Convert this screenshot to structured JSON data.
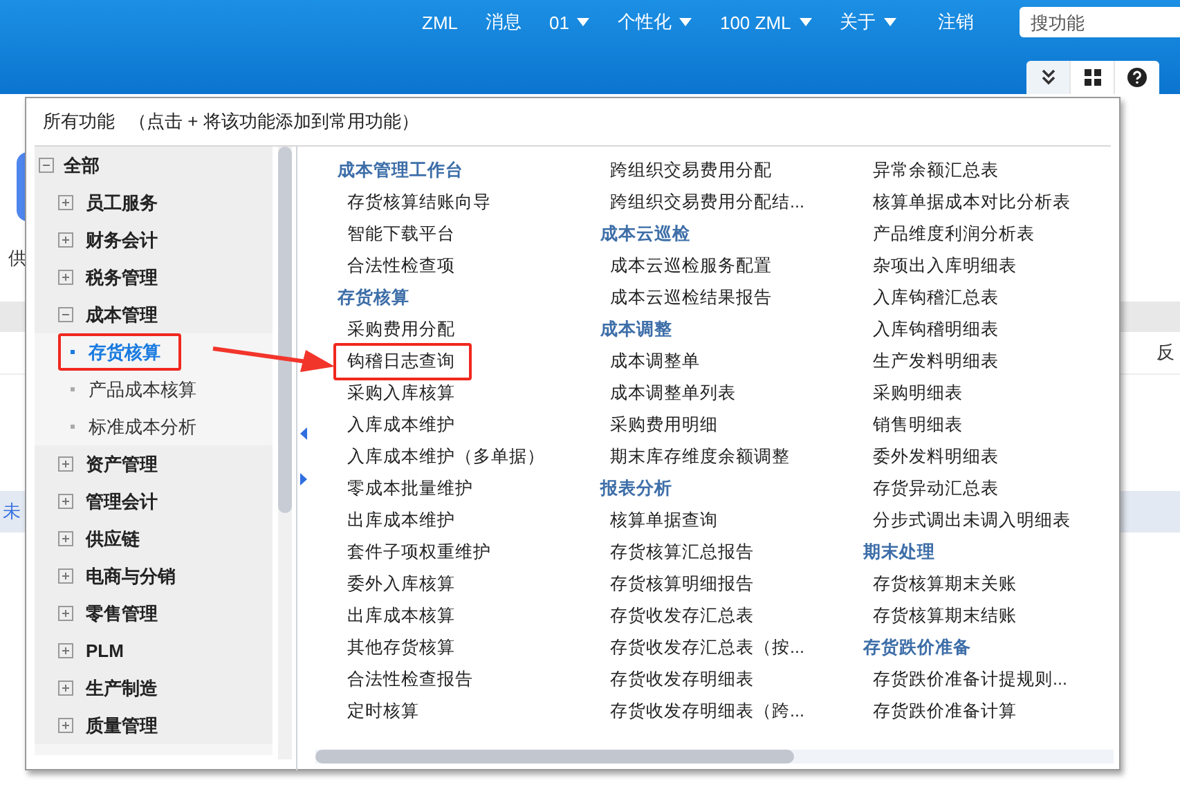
{
  "header": {
    "nav": [
      {
        "label": "ZML",
        "dropdown": false
      },
      {
        "label": "消息",
        "dropdown": false
      },
      {
        "label": "01",
        "dropdown": true
      },
      {
        "label": "个性化",
        "dropdown": true
      },
      {
        "label": "100  ZML",
        "dropdown": true
      },
      {
        "label": "关于",
        "dropdown": true
      },
      {
        "label": "注销",
        "dropdown": false
      }
    ],
    "search": {
      "placeholder": "搜功能"
    }
  },
  "background": {
    "app_label": "供",
    "band_text": "反",
    "notice_text": "未"
  },
  "popup": {
    "title": "所有功能",
    "hint": "（点击 + 将该功能添加到常用功能）",
    "tree": [
      {
        "label": "全部",
        "expanded": true,
        "children": [
          {
            "label": "员工服务",
            "expanded": false
          },
          {
            "label": "财务会计",
            "expanded": false
          },
          {
            "label": "税务管理",
            "expanded": false
          },
          {
            "label": "成本管理",
            "expanded": true,
            "children": [
              {
                "label": "存货核算",
                "selected": true,
                "highlighted": true
              },
              {
                "label": "产品成本核算",
                "selected": false,
                "highlighted": false
              },
              {
                "label": "标准成本分析",
                "selected": false,
                "highlighted": false
              }
            ]
          },
          {
            "label": "资产管理",
            "expanded": false
          },
          {
            "label": "管理会计",
            "expanded": false
          },
          {
            "label": "供应链",
            "expanded": false
          },
          {
            "label": "电商与分销",
            "expanded": false
          },
          {
            "label": "零售管理",
            "expanded": false
          },
          {
            "label": "PLM",
            "expanded": false
          },
          {
            "label": "生产制造",
            "expanded": false
          },
          {
            "label": "质量管理",
            "expanded": false
          }
        ]
      }
    ],
    "columns": [
      [
        {
          "kind": "heading",
          "label": "成本管理工作台"
        },
        {
          "kind": "item",
          "label": "存货核算结账向导",
          "highlighted": false
        },
        {
          "kind": "item",
          "label": "智能下载平台",
          "highlighted": false
        },
        {
          "kind": "item",
          "label": "合法性检查项",
          "highlighted": false
        },
        {
          "kind": "heading",
          "label": "存货核算"
        },
        {
          "kind": "item",
          "label": "采购费用分配",
          "highlighted": false
        },
        {
          "kind": "item",
          "label": "钩稽日志查询",
          "highlighted": true
        },
        {
          "kind": "item",
          "label": "采购入库核算",
          "highlighted": false
        },
        {
          "kind": "item",
          "label": "入库成本维护",
          "highlighted": false
        },
        {
          "kind": "item",
          "label": "入库成本维护（多单据）",
          "highlighted": false
        },
        {
          "kind": "item",
          "label": "零成本批量维护",
          "highlighted": false
        },
        {
          "kind": "item",
          "label": "出库成本维护",
          "highlighted": false
        },
        {
          "kind": "item",
          "label": "套件子项权重维护",
          "highlighted": false
        },
        {
          "kind": "item",
          "label": "委外入库核算",
          "highlighted": false
        },
        {
          "kind": "item",
          "label": "出库成本核算",
          "highlighted": false
        },
        {
          "kind": "item",
          "label": "其他存货核算",
          "highlighted": false
        },
        {
          "kind": "item",
          "label": "合法性检查报告",
          "highlighted": false
        },
        {
          "kind": "item",
          "label": "定时核算",
          "highlighted": false
        }
      ],
      [
        {
          "kind": "item",
          "label": "跨组织交易费用分配",
          "highlighted": false
        },
        {
          "kind": "item",
          "label": "跨组织交易费用分配结...",
          "highlighted": false
        },
        {
          "kind": "heading",
          "label": "成本云巡检"
        },
        {
          "kind": "item",
          "label": "成本云巡检服务配置",
          "highlighted": false
        },
        {
          "kind": "item",
          "label": "成本云巡检结果报告",
          "highlighted": false
        },
        {
          "kind": "heading",
          "label": "成本调整"
        },
        {
          "kind": "item",
          "label": "成本调整单",
          "highlighted": false
        },
        {
          "kind": "item",
          "label": "成本调整单列表",
          "highlighted": false
        },
        {
          "kind": "item",
          "label": "采购费用明细",
          "highlighted": false
        },
        {
          "kind": "item",
          "label": "期末库存维度余额调整",
          "highlighted": false
        },
        {
          "kind": "heading",
          "label": "报表分析"
        },
        {
          "kind": "item",
          "label": "核算单据查询",
          "highlighted": false
        },
        {
          "kind": "item",
          "label": "存货核算汇总报告",
          "highlighted": false
        },
        {
          "kind": "item",
          "label": "存货核算明细报告",
          "highlighted": false
        },
        {
          "kind": "item",
          "label": "存货收发存汇总表",
          "highlighted": false
        },
        {
          "kind": "item",
          "label": "存货收发存汇总表（按...",
          "highlighted": false
        },
        {
          "kind": "item",
          "label": "存货收发存明细表",
          "highlighted": false
        },
        {
          "kind": "item",
          "label": "存货收发存明细表（跨...",
          "highlighted": false
        }
      ],
      [
        {
          "kind": "item",
          "label": "异常余额汇总表",
          "highlighted": false
        },
        {
          "kind": "item",
          "label": "核算单据成本对比分析表",
          "highlighted": false
        },
        {
          "kind": "item",
          "label": "产品维度利润分析表",
          "highlighted": false
        },
        {
          "kind": "item",
          "label": "杂项出入库明细表",
          "highlighted": false
        },
        {
          "kind": "item",
          "label": "入库钩稽汇总表",
          "highlighted": false
        },
        {
          "kind": "item",
          "label": "入库钩稽明细表",
          "highlighted": false
        },
        {
          "kind": "item",
          "label": "生产发料明细表",
          "highlighted": false
        },
        {
          "kind": "item",
          "label": "采购明细表",
          "highlighted": false
        },
        {
          "kind": "item",
          "label": "销售明细表",
          "highlighted": false
        },
        {
          "kind": "item",
          "label": "委外发料明细表",
          "highlighted": false
        },
        {
          "kind": "item",
          "label": "存货异动汇总表",
          "highlighted": false
        },
        {
          "kind": "item",
          "label": "分步式调出未调入明细表",
          "highlighted": false
        },
        {
          "kind": "heading",
          "label": "期末处理"
        },
        {
          "kind": "item",
          "label": "存货核算期末关账",
          "highlighted": false
        },
        {
          "kind": "item",
          "label": "存货核算期末结账",
          "highlighted": false
        },
        {
          "kind": "heading",
          "label": "存货跌价准备"
        },
        {
          "kind": "item",
          "label": "存货跌价准备计提规则...",
          "highlighted": false
        },
        {
          "kind": "item",
          "label": "存货跌价准备计算",
          "highlighted": false
        }
      ]
    ]
  }
}
